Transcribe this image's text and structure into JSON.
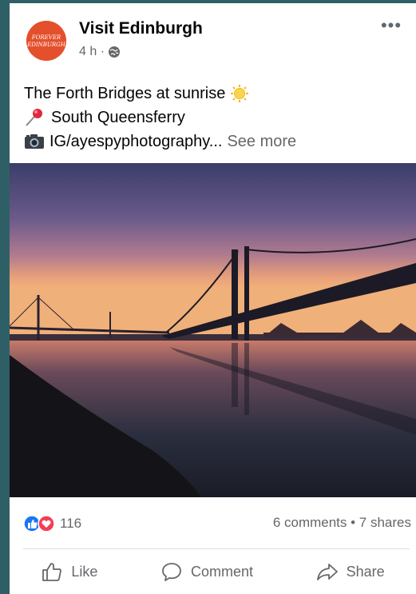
{
  "post": {
    "page_name": "Visit Edinburgh",
    "avatar_text": "FOREVER EDINBURGH",
    "timestamp": "4 h ·",
    "privacy_icon": "globe-icon",
    "menu_icon": "more-options-icon",
    "text_lines": [
      {
        "emoji": "",
        "text": "The Forth Bridges at sunrise",
        "trailing_emoji": "sun-emoji"
      },
      {
        "emoji": "pushpin-emoji",
        "text": "South Queensferry"
      },
      {
        "emoji": "camera-emoji",
        "text": "IG/ayespyphotography..."
      }
    ],
    "see_more": "See more",
    "reaction_count": "116",
    "reaction_icons": [
      "like-reaction-icon",
      "love-reaction-icon"
    ],
    "engagement": "6 comments • 7 shares"
  },
  "actions": [
    {
      "label": "Like",
      "icon": "thumbs-up-icon"
    },
    {
      "label": "Comment",
      "icon": "comment-icon"
    },
    {
      "label": "Share",
      "icon": "share-icon"
    }
  ],
  "colors": {
    "page_background": "#2f5f66",
    "avatar": "#e4502c",
    "like_blue": "#1877f2",
    "love_red": "#f33e58",
    "secondary_text": "#65676b"
  }
}
